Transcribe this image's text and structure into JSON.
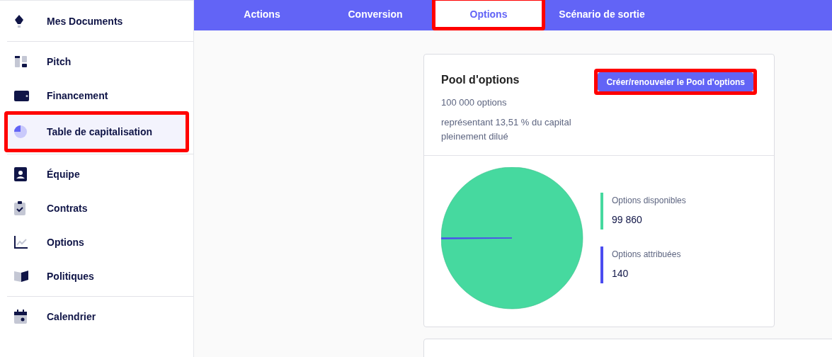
{
  "sidebar": {
    "groups": [
      {
        "items": [
          {
            "label": "Mes Documents",
            "selected": false,
            "highlighted": false
          }
        ]
      },
      {
        "items": [
          {
            "label": "Pitch",
            "selected": false,
            "highlighted": false
          },
          {
            "label": "Financement",
            "selected": false,
            "highlighted": false
          },
          {
            "label": "Table de capitalisation",
            "selected": true,
            "highlighted": true
          }
        ]
      },
      {
        "items": [
          {
            "label": "Équipe",
            "selected": false,
            "highlighted": false
          },
          {
            "label": "Contrats",
            "selected": false,
            "highlighted": false
          },
          {
            "label": "Options",
            "selected": false,
            "highlighted": false
          },
          {
            "label": "Politiques",
            "selected": false,
            "highlighted": false
          }
        ]
      },
      {
        "items": [
          {
            "label": "Calendrier",
            "selected": false,
            "highlighted": false
          }
        ]
      }
    ]
  },
  "tabs": [
    {
      "label": "Actions",
      "selected": false,
      "highlighted": false
    },
    {
      "label": "Conversion",
      "selected": false,
      "highlighted": false
    },
    {
      "label": "Options",
      "selected": true,
      "highlighted": true
    },
    {
      "label": "Scénario de sortie",
      "selected": false,
      "highlighted": false
    }
  ],
  "pool_card": {
    "title": "Pool d'options",
    "count": "100 000 options",
    "share": "représentant 13,51 % du capital pleinement dilué",
    "button": {
      "label": "Créer/renouveler le Pool d'options",
      "highlighted": true
    },
    "chart_data": {
      "type": "pie",
      "categories": [
        "Options disponibles",
        "Options attribuées"
      ],
      "series": [
        {
          "values": [
            99.86,
            0.14
          ]
        }
      ]
    },
    "legend": [
      {
        "value": "99 860",
        "color": "#46d99f"
      },
      {
        "value": "140",
        "color": "#4b4cf0"
      }
    ]
  }
}
